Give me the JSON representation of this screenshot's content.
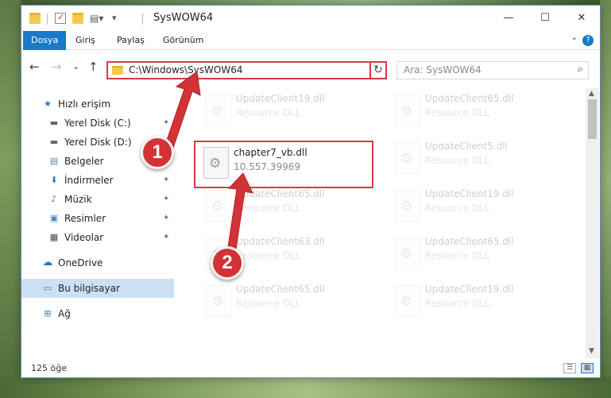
{
  "window": {
    "title": "SysWOW64",
    "minimize": "—",
    "maximize": "☐",
    "close": "✕"
  },
  "ribbon": {
    "tabs": [
      "Dosya",
      "Giriş",
      "Paylaş",
      "Görünüm"
    ],
    "help": "?",
    "collapse": "⌄"
  },
  "nav": {
    "back": "←",
    "forward": "→",
    "recent": "⌄",
    "up": "↑",
    "address": "C:\\Windows\\SysWOW64",
    "address_dropdown": "⌄",
    "refresh": "↻",
    "search_placeholder": "Ara: SysWOW64",
    "search_icon": "⌕"
  },
  "sidebar": {
    "items": [
      {
        "label": "Hızlı erişim",
        "icon": "★",
        "pinned": false
      },
      {
        "label": "Yerel Disk (C:)",
        "icon": "▬",
        "pinned": true
      },
      {
        "label": "Yerel Disk (D:)",
        "icon": "▬",
        "pinned": true
      },
      {
        "label": "Belgeler",
        "icon": "▤",
        "pinned": true
      },
      {
        "label": "İndirmeler",
        "icon": "⬇",
        "pinned": true
      },
      {
        "label": "Müzik",
        "icon": "♪",
        "pinned": true
      },
      {
        "label": "Resimler",
        "icon": "▣",
        "pinned": true
      },
      {
        "label": "Videolar",
        "icon": "▦",
        "pinned": true
      },
      {
        "label": "OneDrive",
        "icon": "☁",
        "pinned": false
      },
      {
        "label": "Bu bilgisayar",
        "icon": "▭",
        "pinned": false,
        "selected": true
      },
      {
        "label": "Ağ",
        "icon": "⊞",
        "pinned": false
      }
    ],
    "pin_glyph": "✦"
  },
  "files": {
    "highlighted": {
      "name": "chapter7_vb.dll",
      "detail": "10.557.39969"
    },
    "faded": [
      {
        "name": "UpdateClient19.dll",
        "detail": "Resource DLL"
      },
      {
        "name": "UpdateClient65.dll",
        "detail": "Resource DLL"
      },
      {
        "name": "UpdateClient5.dll",
        "detail": "Resource DLL"
      },
      {
        "name": "UpdateClient65.dll",
        "detail": "Resource DLL"
      },
      {
        "name": "UpdateClient19.dll",
        "detail": "Resource DLL"
      },
      {
        "name": "UpdateClient63.dll",
        "detail": "Resource DLL"
      },
      {
        "name": "UpdateClient65.dll",
        "detail": "Resource DLL"
      },
      {
        "name": "UpdateClient65.dll",
        "detail": "Resource DLL"
      },
      {
        "name": "UpdateClient19.dll",
        "detail": "Resource DLL"
      }
    ]
  },
  "status": {
    "count": "125 öğe",
    "details_view": "☰",
    "icons_view": "▦"
  },
  "annotations": {
    "step1": "1",
    "step2": "2",
    "color": "#d9393e"
  },
  "scroll": {
    "up": "▲",
    "down": "▼"
  }
}
